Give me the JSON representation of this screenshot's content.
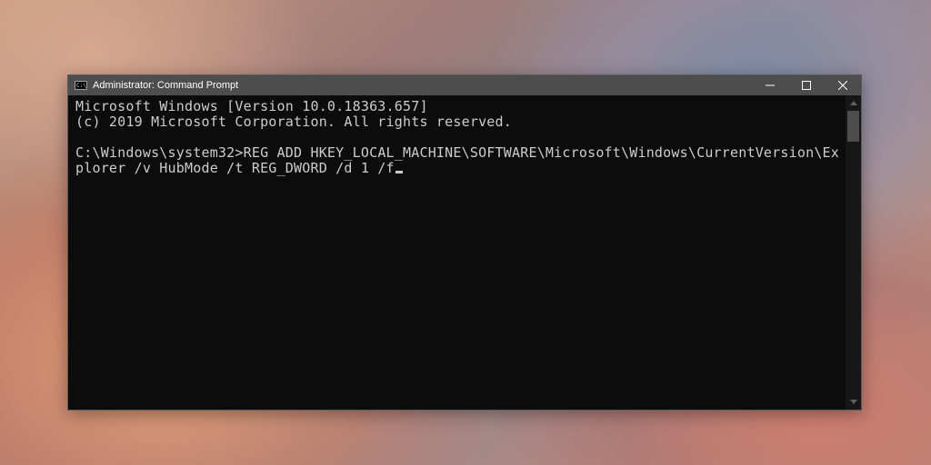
{
  "window": {
    "title": "Administrator: Command Prompt"
  },
  "terminal": {
    "line1": "Microsoft Windows [Version 10.0.18363.657]",
    "line2": "(c) 2019 Microsoft Corporation. All rights reserved.",
    "blank": "",
    "prompt": "C:\\Windows\\system32>",
    "command": "REG ADD HKEY_LOCAL_MACHINE\\SOFTWARE\\Microsoft\\Windows\\CurrentVersion\\Explorer /v HubMode /t REG_DWORD /d 1 /f"
  }
}
